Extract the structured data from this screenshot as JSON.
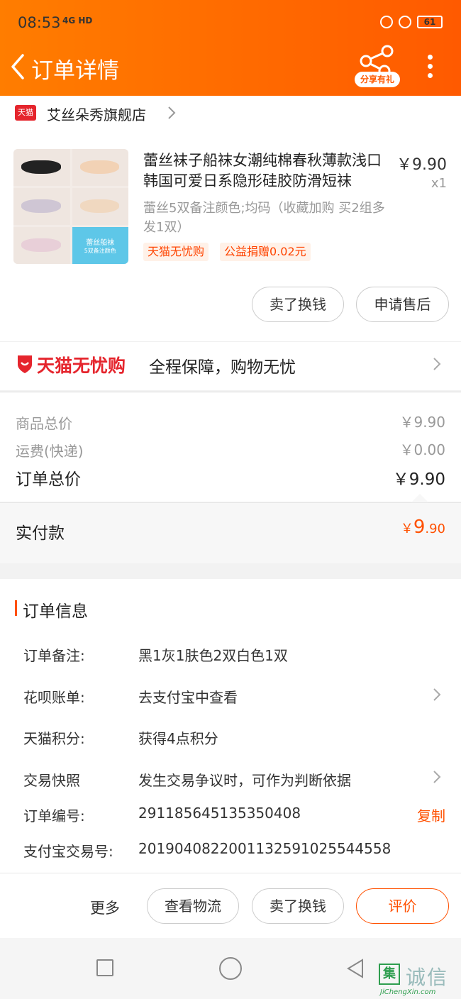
{
  "status_bar": {
    "time": "08:53",
    "network": "4G HD",
    "battery": "61"
  },
  "header": {
    "title": "订单详情",
    "share_label": "分享有礼"
  },
  "store": {
    "badge": "天猫",
    "name": "艾丝朵秀旗舰店"
  },
  "product": {
    "title": "蕾丝袜子船袜女潮纯棉春秋薄款浅口韩国可爱日系隐形硅胶防滑短袜",
    "price": "￥9.90",
    "quantity": "x1",
    "spec": "蕾丝5双备注颜色;均码（收藏加购 买2组多发1双）",
    "tags": [
      "天猫无忧购",
      "公益捐赠0.02元"
    ],
    "thumb_caption": [
      "蕾丝船袜",
      "5双备注颜色"
    ]
  },
  "item_actions": {
    "sell": "卖了换钱",
    "after_sale": "申请售后"
  },
  "guarantee": {
    "brand": "天猫无忧购",
    "desc": "全程保障，购物无忧"
  },
  "fees": {
    "goods_label": "商品总价",
    "goods_value": "￥9.90",
    "shipping_label": "运费(快递)",
    "shipping_value": "￥0.00",
    "total_label": "订单总价",
    "total_value": "￥9.90"
  },
  "payment": {
    "label": "实付款",
    "currency": "￥",
    "integer": "9",
    "decimal": ".90"
  },
  "order_info": {
    "title": "订单信息",
    "rows": [
      {
        "label": "订单备注:",
        "value": "黑1灰1肤色2双白色1双"
      },
      {
        "label": "花呗账单:",
        "value": "去支付宝中查看"
      },
      {
        "label": "天猫积分:",
        "value": "获得4点积分"
      },
      {
        "label": "交易快照",
        "value": "发生交易争议时，可作为判断依据"
      },
      {
        "label": "订单编号:",
        "value": "291185645135350408"
      },
      {
        "label": "支付宝交易号:",
        "value": "2019040822001132591025544558"
      }
    ],
    "copy_label": "复制"
  },
  "bottom_actions": {
    "more": "更多",
    "logistics": "查看物流",
    "sell": "卖了换钱",
    "review": "评价"
  },
  "watermark": {
    "logo": "集",
    "cn": "诚信",
    "en": "JiChengXin.com"
  },
  "colors": {
    "accent": "#ff5000",
    "header_start": "#ff7d00",
    "tmall_red": "#e5252d"
  }
}
